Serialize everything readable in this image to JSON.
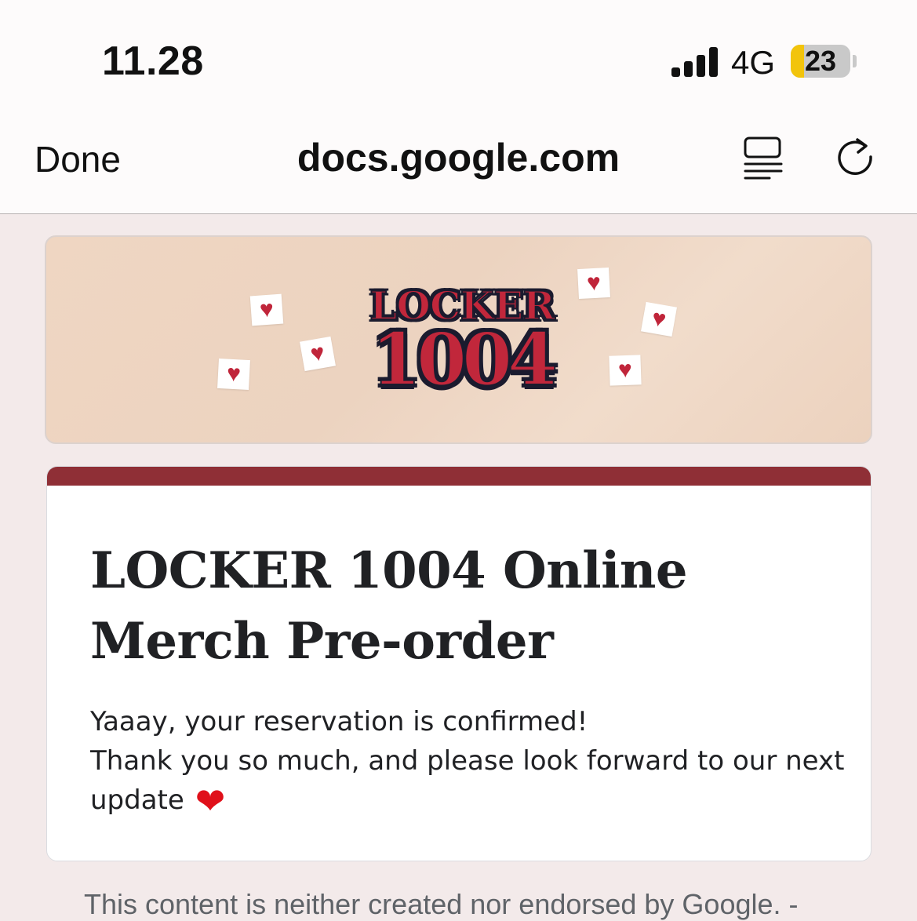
{
  "status_bar": {
    "time": "11.28",
    "network": "4G",
    "battery_percent": "23",
    "battery_level": 0.23,
    "battery_color": "#f2c40c"
  },
  "nav": {
    "done_label": "Done",
    "url": "docs.google.com"
  },
  "banner": {
    "logo_line1": "LOCKER",
    "logo_line2": "1004",
    "heart_glyph": "♥"
  },
  "form": {
    "accent_color": "#8f2f36",
    "title": "LOCKER 1004 Online Merch Pre-order",
    "lines": [
      "Yaaay, your reservation is confirmed!",
      "Thank you so much, and please look forward to our next",
      "update"
    ],
    "heart_emoji": "❤"
  },
  "footer": {
    "disclaimer": "This content is neither created nor endorsed by Google. -"
  }
}
